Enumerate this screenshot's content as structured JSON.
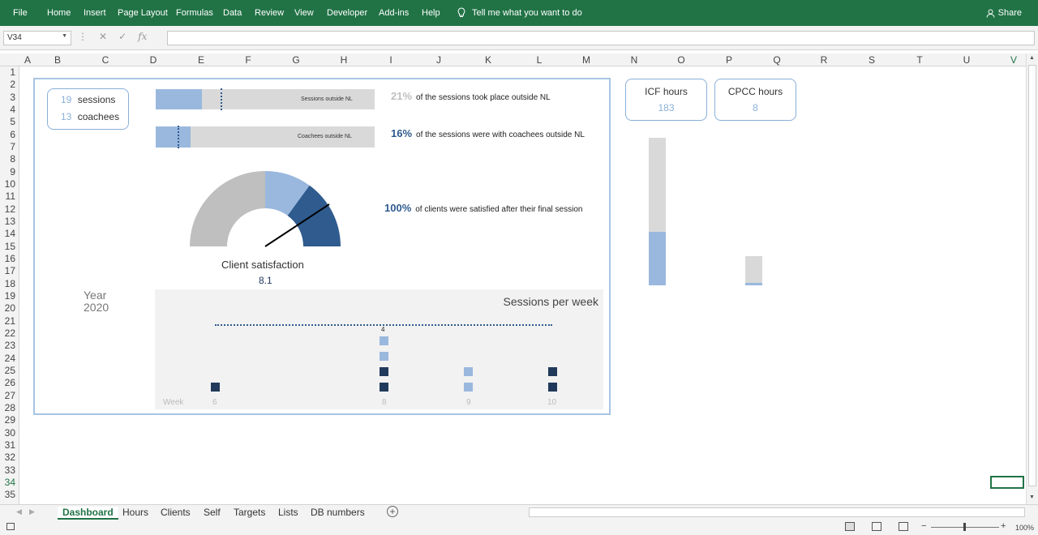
{
  "ribbon": {
    "tabs": [
      "File",
      "Home",
      "Insert",
      "Page Layout",
      "Formulas",
      "Data",
      "Review",
      "View",
      "Developer",
      "Add-ins",
      "Help"
    ],
    "tell_me": "Tell me what you want to do",
    "share": "Share",
    "bg_color": "#217346"
  },
  "formula_bar": {
    "name_box": "V34",
    "formula": ""
  },
  "columns": [
    "A",
    "B",
    "C",
    "D",
    "E",
    "F",
    "G",
    "H",
    "I",
    "J",
    "K",
    "L",
    "M",
    "N",
    "O",
    "P",
    "Q",
    "R",
    "S",
    "T",
    "U",
    "V"
  ],
  "rows": [
    "1",
    "2",
    "3",
    "4",
    "5",
    "6",
    "7",
    "8",
    "9",
    "10",
    "11",
    "12",
    "13",
    "14",
    "15",
    "16",
    "17",
    "18",
    "19",
    "20",
    "21",
    "22",
    "23",
    "24",
    "25",
    "26",
    "27",
    "28",
    "29",
    "30",
    "31",
    "32",
    "33",
    "34",
    "35"
  ],
  "dashboard": {
    "sessions_count": "19",
    "sessions_label": "sessions",
    "coachees_count": "13",
    "coachees_label": "coachees",
    "bar1_label": "Sessions outside NL",
    "bar1_fraction": 0.21,
    "bar2_label": "Coachees outside NL",
    "bar2_fraction": 0.16,
    "pct1": "21%",
    "pct1_text": "of the sessions took place outside NL",
    "pct2": "16%",
    "pct2_text": "of the sessions were with coachees outside NL",
    "pct3": "100%",
    "pct3_text": "of clients were satisfied after their final session",
    "gauge_title": "Client satisfaction",
    "gauge_value": "8.1",
    "year_label": "Year",
    "year_value": "2020",
    "spw_title": "Sessions per week",
    "week_label": "Week",
    "weeks": [
      "6",
      "8",
      "9",
      "10"
    ],
    "peak_label": "4"
  },
  "hours": {
    "icf_label": "ICF hours",
    "icf_value": "183",
    "cpcc_label": "CPCC hours",
    "cpcc_value": "8"
  },
  "sheets": [
    "Dashboard",
    "Hours",
    "Clients",
    "Self",
    "Targets",
    "Lists",
    "DB numbers"
  ],
  "status": {
    "zoom": "100%"
  },
  "colors": {
    "accent_light": "#9ab8de",
    "accent_dark": "#2f5b8e",
    "navy": "#213a5c",
    "gray": "#bfbfbf"
  }
}
